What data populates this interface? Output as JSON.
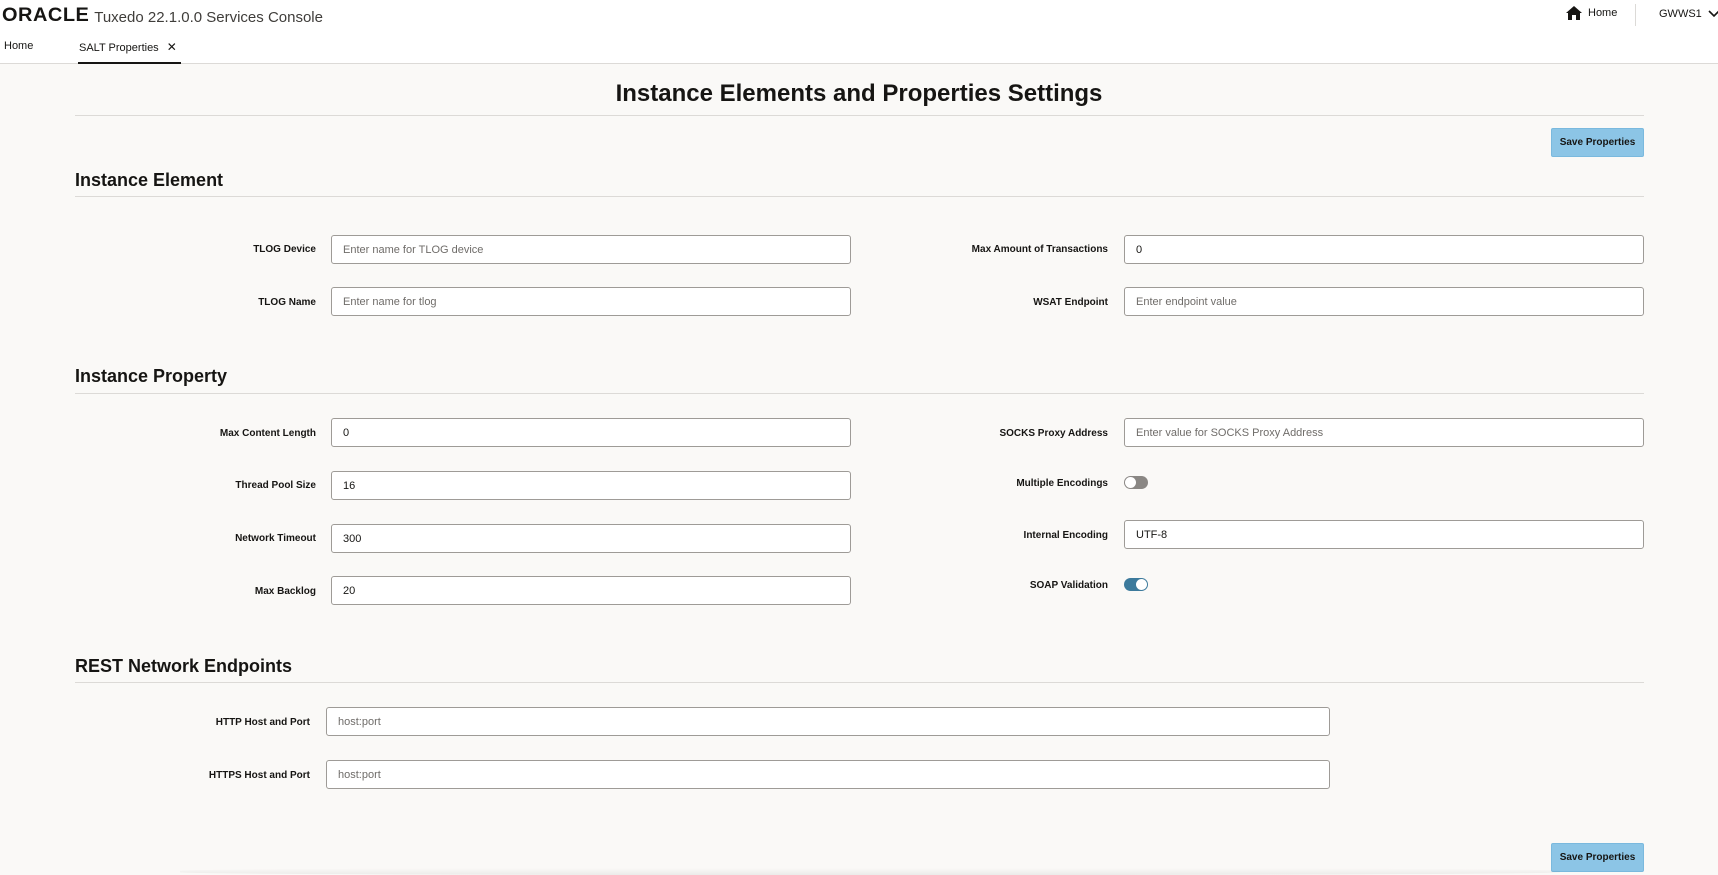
{
  "header": {
    "brand_logo": "ORACLE",
    "app_title": "Tuxedo 22.1.0.0 Services Console",
    "home_label": "Home",
    "user_label": "GWWS1"
  },
  "tabs": [
    {
      "label": "Home"
    },
    {
      "label": "SALT Properties",
      "close": "✕"
    }
  ],
  "page": {
    "title": "Instance Elements and Properties Settings",
    "save_label": "Save Properties"
  },
  "instance_element": {
    "title": "Instance Element",
    "tlog_device": {
      "label": "TLOG Device",
      "value": "",
      "placeholder": "Enter name for TLOG device"
    },
    "tlog_name": {
      "label": "TLOG Name",
      "value": "",
      "placeholder": "Enter name for tlog"
    },
    "max_transactions": {
      "label": "Max Amount of Transactions",
      "value": "0",
      "placeholder": ""
    },
    "wsat_endpoint": {
      "label": "WSAT Endpoint",
      "value": "",
      "placeholder": "Enter endpoint value"
    }
  },
  "instance_property": {
    "title": "Instance Property",
    "max_content_length": {
      "label": "Max Content Length",
      "value": "0"
    },
    "thread_pool_size": {
      "label": "Thread Pool Size",
      "value": "16"
    },
    "network_timeout": {
      "label": "Network Timeout",
      "value": "300"
    },
    "max_backlog": {
      "label": "Max Backlog",
      "value": "20"
    },
    "socks_proxy": {
      "label": "SOCKS Proxy Address",
      "value": "",
      "placeholder": "Enter value for SOCKS Proxy Address"
    },
    "multiple_encodings": {
      "label": "Multiple Encodings",
      "enabled": false
    },
    "internal_encoding": {
      "label": "Internal Encoding",
      "value": "UTF-8"
    },
    "soap_validation": {
      "label": "SOAP Validation",
      "enabled": true
    }
  },
  "rest_endpoints": {
    "title": "REST Network Endpoints",
    "http": {
      "label": "HTTP Host and Port",
      "value": "",
      "placeholder": "host:port"
    },
    "https": {
      "label": "HTTPS Host and Port",
      "value": "",
      "placeholder": "host:port"
    }
  },
  "colors": {
    "save_button": "#8cc5e6",
    "toggle_on": "#3c7a9c",
    "toggle_off": "#8a8784"
  },
  "icons": {
    "home": "home-icon",
    "user_menu": "chevron-down-icon",
    "tab_close": "close-icon"
  }
}
